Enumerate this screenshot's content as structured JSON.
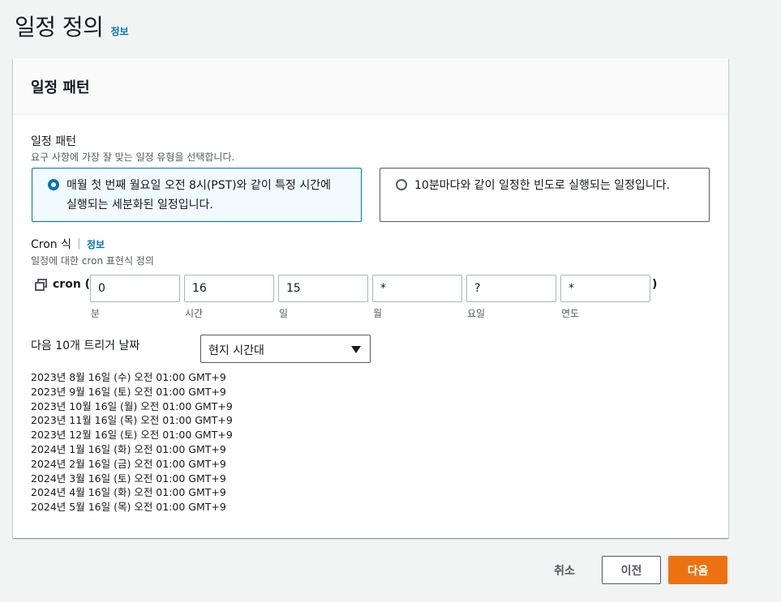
{
  "page": {
    "title": "일정 정의",
    "info": "정보"
  },
  "panel": {
    "title": "일정 패턴",
    "field_label": "일정 패턴",
    "field_desc": "요구 사항에 가장 잘 맞는 일정 유형을 선택합니다.",
    "options": [
      {
        "line1": "매월 첫 번째 월요일 오전 8시(PST)와 같이 특정 시간에",
        "line2": "실행되는 세분화된 일정입니다.",
        "selected": true
      },
      {
        "text": "10분마다와 같이 일정한 빈도로 실행되는 일정입니다.",
        "selected": false
      }
    ],
    "cron": {
      "label": "Cron 식",
      "info": "정보",
      "desc": "일정에 대한 cron 표현식 정의",
      "open": "cron (",
      "close": ")",
      "fields": [
        {
          "value": "0",
          "label": "분"
        },
        {
          "value": "16",
          "label": "시간"
        },
        {
          "value": "15",
          "label": "일"
        },
        {
          "value": "*",
          "label": "월"
        },
        {
          "value": "?",
          "label": "요일"
        },
        {
          "value": "*",
          "label": "연도"
        }
      ]
    },
    "next_triggers": {
      "label": "다음 10개 트리거 날짜",
      "timezone": "현지 시간대",
      "dates": [
        "2023년 8월 16일 (수) 오전 01:00 GMT+9",
        "2023년 9월 16일 (토) 오전 01:00 GMT+9",
        "2023년 10월 16일 (월) 오전 01:00 GMT+9",
        "2023년 11월 16일 (목) 오전 01:00 GMT+9",
        "2023년 12월 16일 (토) 오전 01:00 GMT+9",
        "2024년 1월 16일 (화) 오전 01:00 GMT+9",
        "2024년 2월 16일 (금) 오전 01:00 GMT+9",
        "2024년 3월 16일 (토) 오전 01:00 GMT+9",
        "2024년 4월 16일 (화) 오전 01:00 GMT+9",
        "2024년 5월 16일 (목) 오전 01:00 GMT+9"
      ]
    }
  },
  "footer": {
    "cancel": "취소",
    "previous": "이전",
    "next": "다음"
  },
  "colors": {
    "accent": "#0073bb",
    "primary_button": "#ec7211",
    "selected_tile_bg": "#f1faff"
  }
}
